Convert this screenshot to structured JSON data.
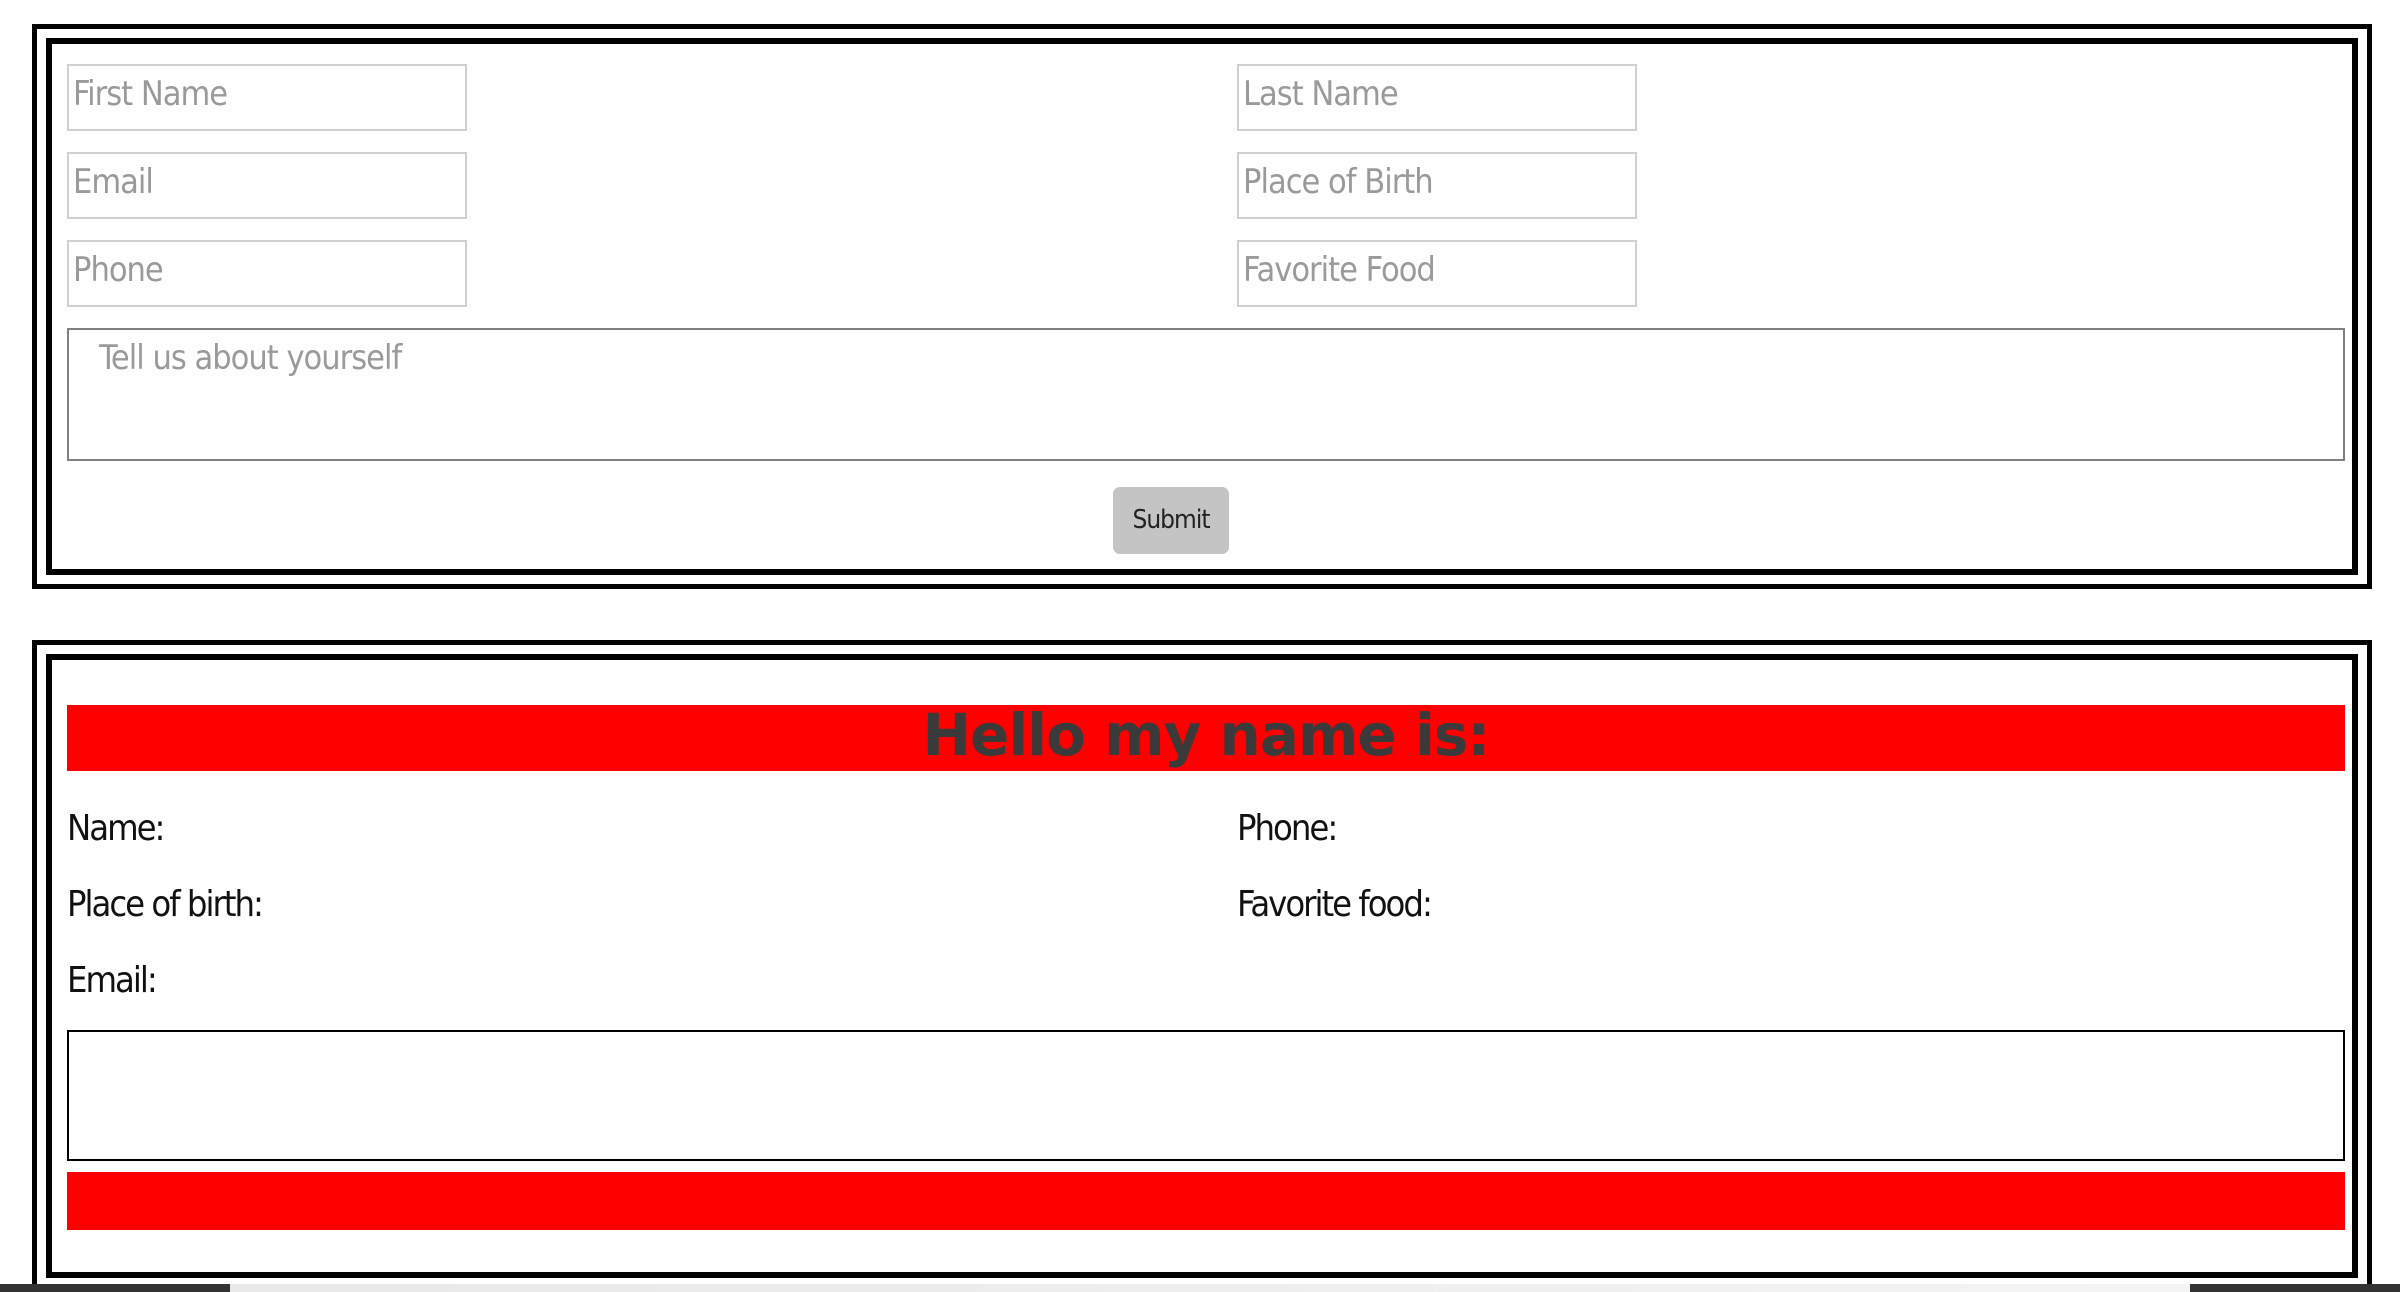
{
  "form": {
    "first_name_placeholder": "First Name",
    "last_name_placeholder": "Last Name",
    "email_placeholder": "Email",
    "place_of_birth_placeholder": "Place of Birth",
    "phone_placeholder": "Phone",
    "favorite_food_placeholder": "Favorite Food",
    "about_placeholder": "Tell us about yourself",
    "submit_label": "Submit"
  },
  "card": {
    "heading": "Hello my name is:",
    "name_label": "Name:",
    "phone_label": "Phone:",
    "place_of_birth_label": "Place of birth:",
    "favorite_food_label": "Favorite food:",
    "email_label": "Email:"
  },
  "colors": {
    "banner": "#ff0000",
    "border": "#000000",
    "button": "#c4c4c4"
  }
}
